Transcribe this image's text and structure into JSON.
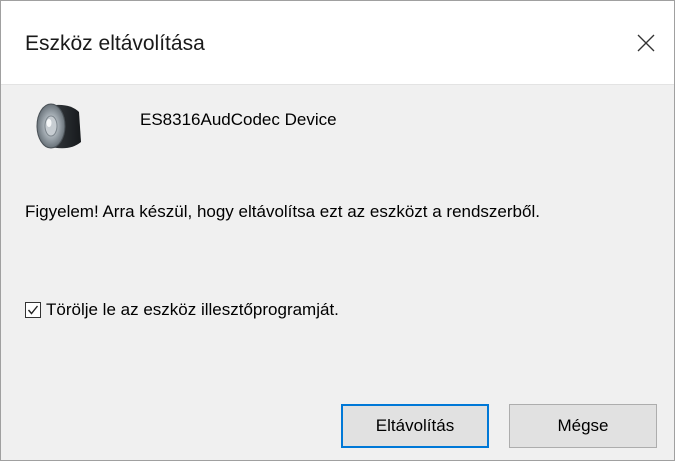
{
  "window": {
    "title": "Eszköz eltávolítása"
  },
  "device": {
    "name": "ES8316AudCodec Device",
    "icon": "speaker-icon"
  },
  "message": {
    "warning": "Figyelem! Arra készül, hogy eltávolítsa ezt az eszközt a rendszerből."
  },
  "options": {
    "delete_driver_label": "Törölje le az eszköz illesztőprogramját.",
    "delete_driver_checked": true
  },
  "buttons": {
    "uninstall_label": "Eltávolítás",
    "cancel_label": "Mégse"
  },
  "colors": {
    "accent": "#0078d7",
    "dialog_bg": "#f0f0f0",
    "button_bg": "#e1e1e1"
  }
}
